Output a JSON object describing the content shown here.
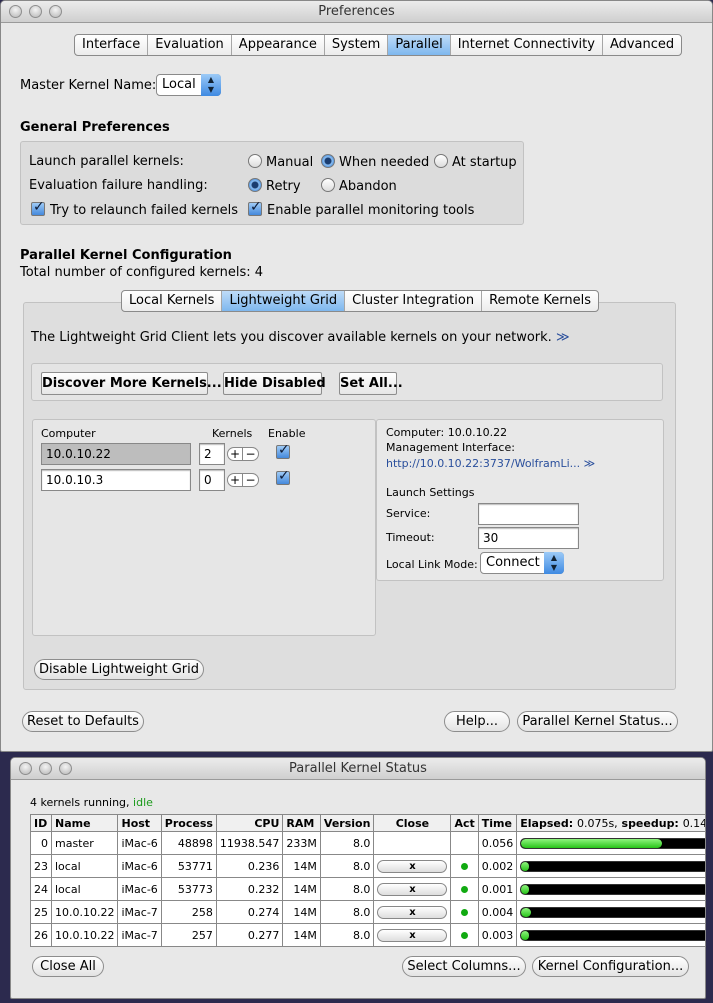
{
  "prefs": {
    "title": "Preferences",
    "tabs": [
      "Interface",
      "Evaluation",
      "Appearance",
      "System",
      "Parallel",
      "Internet Connectivity",
      "Advanced"
    ],
    "master_kernel_label": "Master Kernel Name:",
    "master_kernel_value": "Local",
    "general_title": "General Preferences",
    "launch_label": "Launch parallel kernels:",
    "launch_options": [
      "Manual",
      "When needed",
      "At startup"
    ],
    "failure_label": "Evaluation failure handling:",
    "failure_options": [
      "Retry",
      "Abandon"
    ],
    "relaunch_label": "Try to relaunch failed kernels",
    "monitoring_label": "Enable parallel monitoring tools",
    "config_title": "Parallel Kernel Configuration",
    "total_label": "Total number of configured kernels: 4",
    "config_tabs": [
      "Local Kernels",
      "Lightweight Grid",
      "Cluster Integration",
      "Remote Kernels"
    ],
    "description": "The Lightweight Grid Client lets you discover available kernels on your network.",
    "more_link": "≫",
    "discover_button": "Discover More Kernels...",
    "hide_disabled_button": "Hide Disabled",
    "set_all_button": "Set All...",
    "grid_headers": {
      "computer": "Computer",
      "kernels": "Kernels",
      "enable": "Enable"
    },
    "grid_rows": [
      {
        "computer": "10.0.10.22",
        "kernels": "2"
      },
      {
        "computer": "10.0.10.3",
        "kernels": "0"
      }
    ],
    "detail": {
      "computer": "Computer: 10.0.10.22",
      "mgmt_label": "Management Interface:",
      "mgmt_link": "http://10.0.10.22:3737/WolframLi...",
      "mgmt_more": "≫",
      "launch_settings": "Launch Settings",
      "service_label": "Service:",
      "service_value": "",
      "timeout_label": "Timeout:",
      "timeout_value": "30",
      "linkmode_label": "Local Link Mode:",
      "linkmode_value": "Connect"
    },
    "disable_grid_button": "Disable Lightweight Grid",
    "reset_button": "Reset to Defaults",
    "help_button": "Help...",
    "status_button": "Parallel Kernel Status..."
  },
  "status": {
    "title": "Parallel Kernel Status",
    "running": "4 kernels running,",
    "state": "idle",
    "headers": [
      "ID",
      "Name",
      "Host",
      "Process",
      "CPU",
      "RAM",
      "Version",
      "Close",
      "Act",
      "Time"
    ],
    "elapsed_label": "Elapsed:",
    "elapsed_value": "0.075s,",
    "speedup_label": "speedup:",
    "speedup_value": "0.14",
    "close_glyph": "x",
    "rows": [
      {
        "id": "0",
        "name": "master",
        "host": "iMac-6",
        "process": "48898",
        "cpu": "11938.547",
        "ram": "233M",
        "version": "8.0",
        "time": "0.056",
        "bar": 0.74
      },
      {
        "id": "23",
        "name": "local",
        "host": "iMac-6",
        "process": "53771",
        "cpu": "0.236",
        "ram": "14M",
        "version": "8.0",
        "time": "0.002",
        "bar": 0.03
      },
      {
        "id": "24",
        "name": "local",
        "host": "iMac-6",
        "process": "53773",
        "cpu": "0.232",
        "ram": "14M",
        "version": "8.0",
        "time": "0.001",
        "bar": 0.02
      },
      {
        "id": "25",
        "name": "10.0.10.22",
        "host": "iMac-7",
        "process": "258",
        "cpu": "0.274",
        "ram": "14M",
        "version": "8.0",
        "time": "0.004",
        "bar": 0.05
      },
      {
        "id": "26",
        "name": "10.0.10.22",
        "host": "iMac-7",
        "process": "257",
        "cpu": "0.277",
        "ram": "14M",
        "version": "8.0",
        "time": "0.003",
        "bar": 0.04
      }
    ],
    "close_all_button": "Close All",
    "select_columns_button": "Select Columns...",
    "kernel_config_button": "Kernel Configuration..."
  }
}
